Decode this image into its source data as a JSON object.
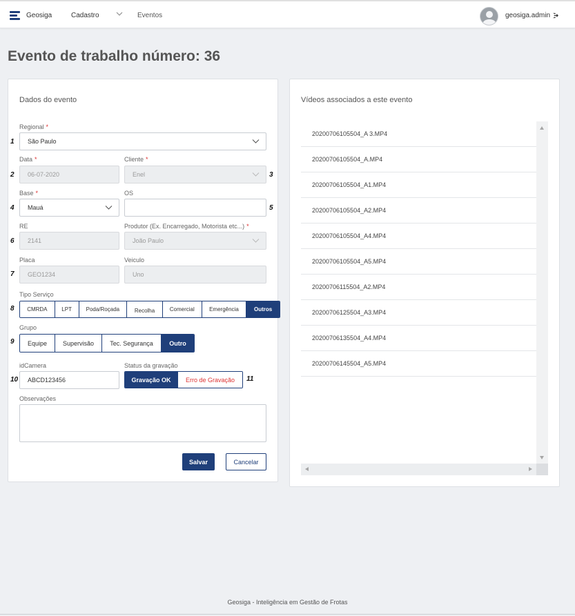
{
  "header": {
    "brand": "Geosiga",
    "nav_cadastro": "Cadastro",
    "nav_eventos": "Eventos",
    "user": "geosiga.admin",
    "accent": "#1f3f7a"
  },
  "page": {
    "title": "Evento de trabalho número: 36"
  },
  "form": {
    "title": "Dados do evento",
    "regional": {
      "label": "Regional",
      "required": "*",
      "value": "São Paulo",
      "num": "1"
    },
    "data": {
      "label": "Data",
      "required": "*",
      "value": "06-07-2020",
      "num": "2"
    },
    "cliente": {
      "label": "Cliente",
      "required": "*",
      "value": "Enel",
      "num": "3"
    },
    "base": {
      "label": "Base",
      "required": "*",
      "value": "Mauá",
      "num": "4"
    },
    "os": {
      "label": "OS",
      "value": "",
      "num": "5"
    },
    "re": {
      "label": "RE",
      "value": "2141",
      "num": "6"
    },
    "produtor": {
      "label": "Produtor (Ex. Encarregado, Motorista etc...)",
      "required": "*",
      "value": "João Paulo"
    },
    "placa": {
      "label": "Placa",
      "value": "GEO1234",
      "num": "7"
    },
    "veiculo": {
      "label": "Veiculo",
      "value": "Uno"
    },
    "tipo_servico": {
      "label": "Tipo Serviço",
      "num": "8",
      "options": [
        "CMRDA",
        "LPT",
        "Poda/Roçada",
        "Recolha",
        "Comercial",
        "Emergência",
        "Outros"
      ],
      "selected": "Outros"
    },
    "grupo": {
      "label": "Grupo",
      "num": "9",
      "options": [
        "Equipe",
        "Supervisão",
        "Tec. Segurança",
        "Outro"
      ],
      "selected": "Outro"
    },
    "idcamera": {
      "label": "idCamera",
      "value": "ABCD123456",
      "num": "10"
    },
    "status_gravacao": {
      "label": "Status da gravação",
      "num": "11",
      "ok": "Gravação OK",
      "erro": "Erro de Gravação",
      "error_color": "#d33"
    },
    "observacoes": {
      "label": "Observações",
      "value": ""
    },
    "save": "Salvar",
    "cancel": "Cancelar"
  },
  "videos": {
    "title": "Vídeos associados a este evento",
    "items": [
      "20200706105504_A 3.MP4",
      "20200706105504_A.MP4",
      "20200706105504_A1.MP4",
      "20200706105504_A2.MP4",
      "20200706105504_A4.MP4",
      "20200706105504_A5.MP4",
      "20200706115504_A2.MP4",
      "20200706125504_A3.MP4",
      "20200706135504_A4.MP4",
      "20200706145504_A5.MP4"
    ]
  },
  "footer": {
    "text": "Geosiga - Inteligência em Gestão de Frotas"
  }
}
